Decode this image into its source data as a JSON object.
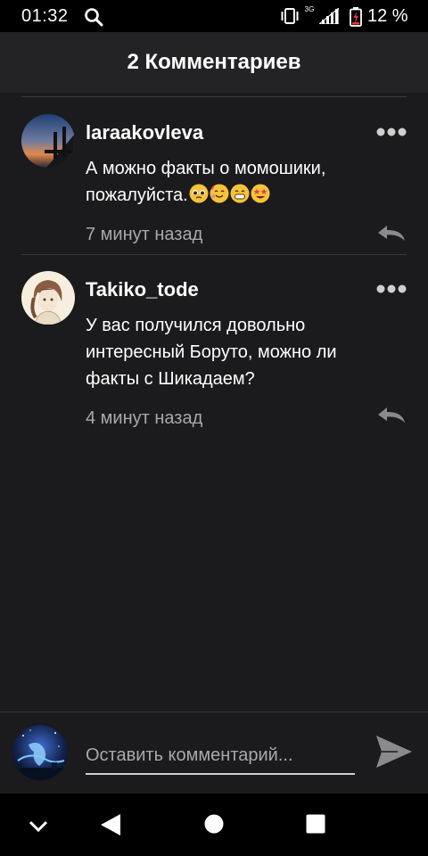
{
  "status_bar": {
    "time": "01:32",
    "network": "3G",
    "battery": "12 %"
  },
  "header": {
    "title": "2 Комментариев"
  },
  "comments": [
    {
      "username": "laraakovleva",
      "text": "А можно факты о момошики, пожалуйста.",
      "emojis": [
        "pleading-face-emoji",
        "smiling-face-with-hearts-emoji",
        "grinning-face-emoji",
        "star-struck-emoji"
      ],
      "time": "7 минут назад"
    },
    {
      "username": "Takiko_tode",
      "text": "У вас получился довольно интересный Боруто, можно ли факты с Шикадаем?",
      "time": "4 минут назад"
    }
  ],
  "input": {
    "placeholder": "Оставить комментарий..."
  },
  "colors": {
    "background": "#1b1a1c",
    "header": "#232224",
    "text": "#ffffff",
    "muted": "#a9a8aa",
    "divider": "#3a393c"
  }
}
